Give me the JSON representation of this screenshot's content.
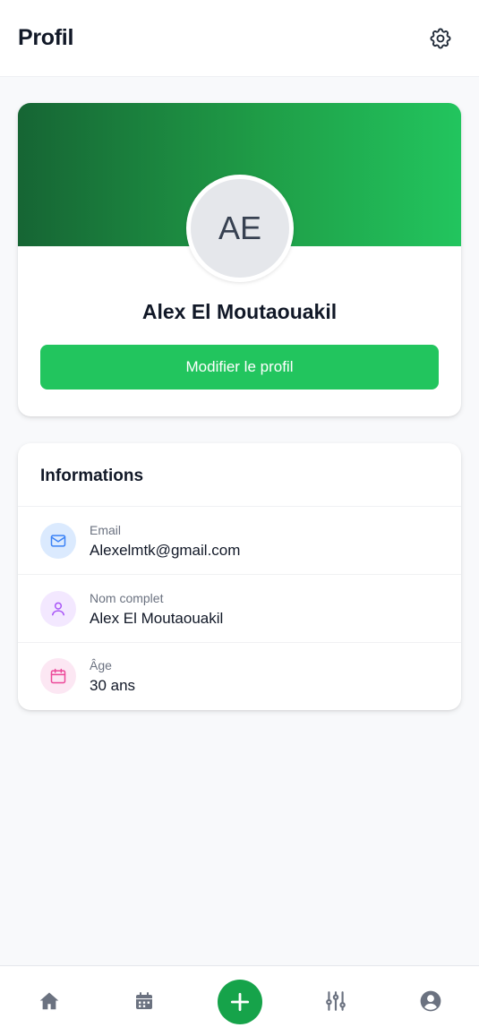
{
  "header": {
    "title": "Profil",
    "settings_icon": "gear-icon"
  },
  "profile": {
    "initials": "AE",
    "name": "Alex El Moutaouakil",
    "edit_label": "Modifier le profil",
    "banner_colors": [
      "#166534",
      "#22c55e"
    ]
  },
  "info": {
    "heading": "Informations",
    "rows": [
      {
        "icon": "mail-icon",
        "label": "Email",
        "value": "Alexelmtk@gmail.com",
        "icon_bg": "#dbeafe",
        "icon_color": "#3b82f6"
      },
      {
        "icon": "user-icon",
        "label": "Nom complet",
        "value": "Alex El Moutaouakil",
        "icon_bg": "#f3e8ff",
        "icon_color": "#a855f7"
      },
      {
        "icon": "calendar-icon",
        "label": "Âge",
        "value": "30 ans",
        "icon_bg": "#fce7f3",
        "icon_color": "#ec4899"
      }
    ]
  },
  "nav": {
    "items": [
      "home-icon",
      "calendar-icon",
      "add-icon",
      "sliders-icon",
      "user-circle-icon"
    ],
    "accent": "#16a34a",
    "icon_color": "#6b7280"
  }
}
